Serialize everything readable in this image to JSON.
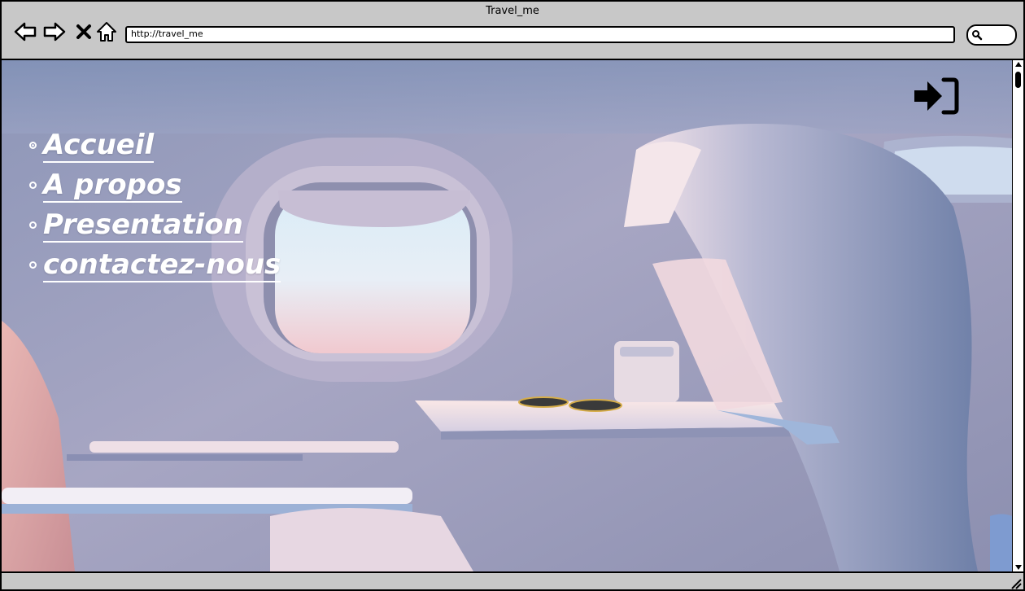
{
  "window": {
    "title": "Travel_me"
  },
  "browser": {
    "url": "http://travel_me",
    "buttons": {
      "back": "back-icon",
      "forward": "forward-icon",
      "stop": "close-icon",
      "home": "home-icon",
      "search": "search-icon"
    }
  },
  "page": {
    "menu": [
      {
        "label": "Accueil",
        "active": true
      },
      {
        "label": "A propos",
        "active": false
      },
      {
        "label": "Presentation",
        "active": false
      },
      {
        "label": "contactez-nous",
        "active": false
      }
    ],
    "login_icon": "sign-in-icon",
    "colors": {
      "menu_text": "#ffffff",
      "chrome": "#c8c8c8"
    }
  }
}
